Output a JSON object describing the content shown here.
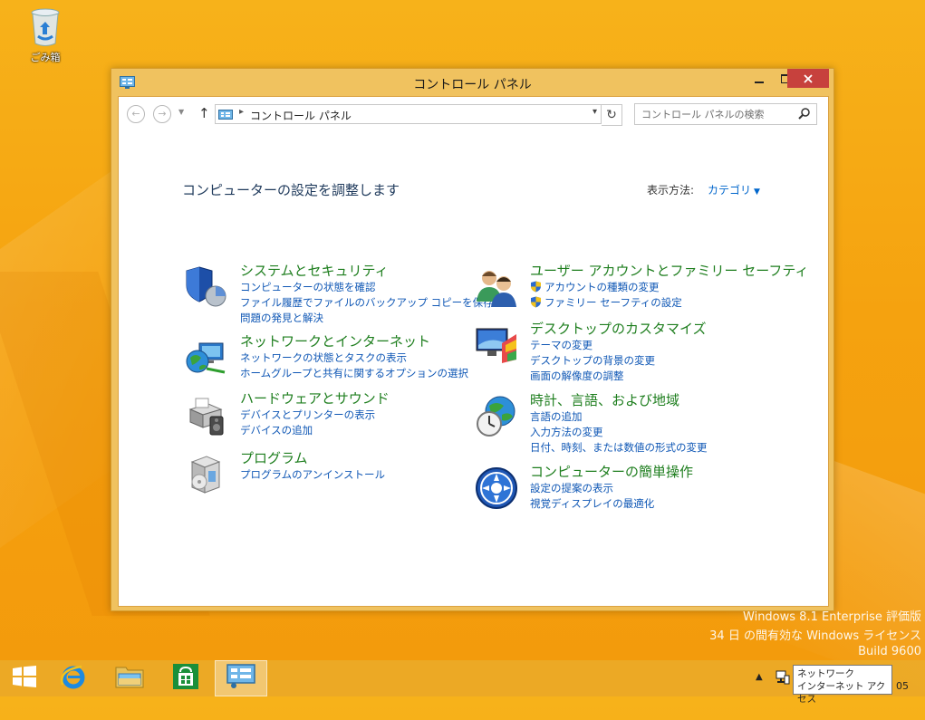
{
  "desktop": {
    "recycle_bin_label": "ごみ箱",
    "watermark": {
      "line1": "Windows 8.1 Enterprise 評価版",
      "line2": "34 日 の間有効な Windows ライセンス",
      "line3": "Build 9600"
    }
  },
  "window": {
    "title": "コントロール パネル",
    "address_path": "コントロール パネル",
    "search_placeholder": "コントロール パネルの検索",
    "heading": "コンピューターの設定を調整します",
    "view_by_label": "表示方法:",
    "view_by_value": "カテゴリ"
  },
  "categories": [
    {
      "title": "システムとセキュリティ",
      "links": [
        "コンピューターの状態を確認",
        "ファイル履歴でファイルのバックアップ コピーを保存",
        "問題の発見と解決"
      ]
    },
    {
      "title": "ネットワークとインターネット",
      "links": [
        "ネットワークの状態とタスクの表示",
        "ホームグループと共有に関するオプションの選択"
      ]
    },
    {
      "title": "ハードウェアとサウンド",
      "links": [
        "デバイスとプリンターの表示",
        "デバイスの追加"
      ]
    },
    {
      "title": "プログラム",
      "links": [
        "プログラムのアンインストール"
      ]
    },
    {
      "title": "ユーザー アカウントとファミリー セーフティ",
      "links": [
        "アカウントの種類の変更",
        "ファミリー セーフティの設定"
      ]
    },
    {
      "title": "デスクトップのカスタマイズ",
      "links": [
        "テーマの変更",
        "デスクトップの背景の変更",
        "画面の解像度の調整"
      ]
    },
    {
      "title": "時計、言語、および地域",
      "links": [
        "言語の追加",
        "入力方法の変更",
        "日付、時刻、または数値の形式の変更"
      ]
    },
    {
      "title": "コンピューターの簡単操作",
      "links": [
        "設定の提案の表示",
        "視覚ディスプレイの最適化"
      ]
    }
  ],
  "taskbar": {
    "tooltip_line1": "ネットワーク",
    "tooltip_line2": "インターネット アクセス",
    "clock_fragment": "05"
  }
}
